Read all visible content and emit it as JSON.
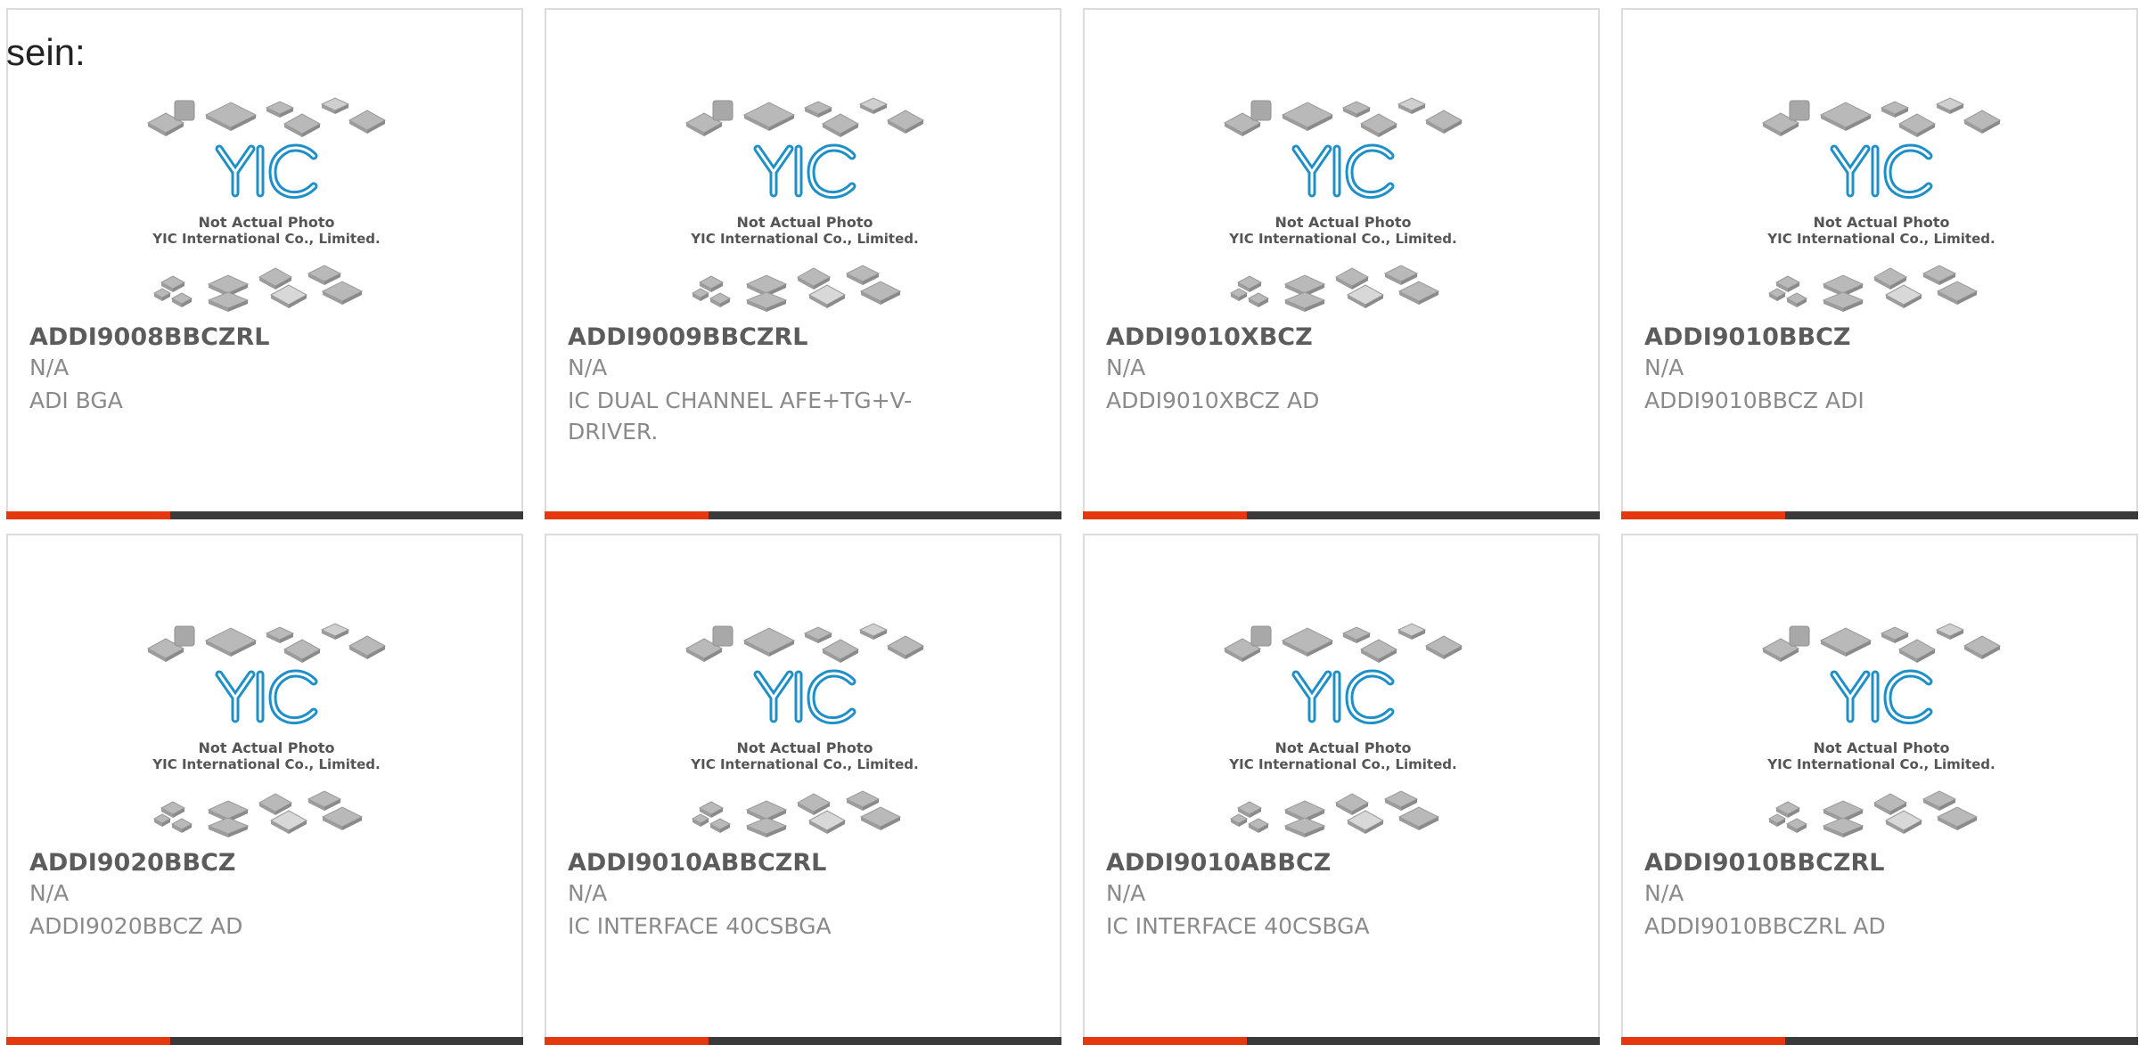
{
  "intro_text": "sein:",
  "photo": {
    "caption_line1": "Not Actual Photo",
    "caption_line2": "YIC International Co., Limited.",
    "logo_text": "YIC",
    "logo_color": "#1f8fc8"
  },
  "colors": {
    "accent": "#e6380f",
    "bar": "#3a3a3a",
    "border": "#dcdcdc"
  },
  "products": [
    {
      "part": "ADDI9008BBCZRL",
      "manufacturer": "N/A",
      "description": "ADI BGA"
    },
    {
      "part": "ADDI9009BBCZRL",
      "manufacturer": "N/A",
      "description": "IC DUAL CHANNEL AFE+TG+V-DRIVER."
    },
    {
      "part": "ADDI9010XBCZ",
      "manufacturer": "N/A",
      "description": "ADDI9010XBCZ AD"
    },
    {
      "part": "ADDI9010BBCZ",
      "manufacturer": "N/A",
      "description": "ADDI9010BBCZ ADI"
    },
    {
      "part": "ADDI9020BBCZ",
      "manufacturer": "N/A",
      "description": "ADDI9020BBCZ AD"
    },
    {
      "part": "ADDI9010ABBCZRL",
      "manufacturer": "N/A",
      "description": "IC INTERFACE 40CSBGA"
    },
    {
      "part": "ADDI9010ABBCZ",
      "manufacturer": "N/A",
      "description": "IC INTERFACE 40CSBGA"
    },
    {
      "part": "ADDI9010BBCZRL",
      "manufacturer": "N/A",
      "description": "ADDI9010BBCZRL AD"
    }
  ]
}
